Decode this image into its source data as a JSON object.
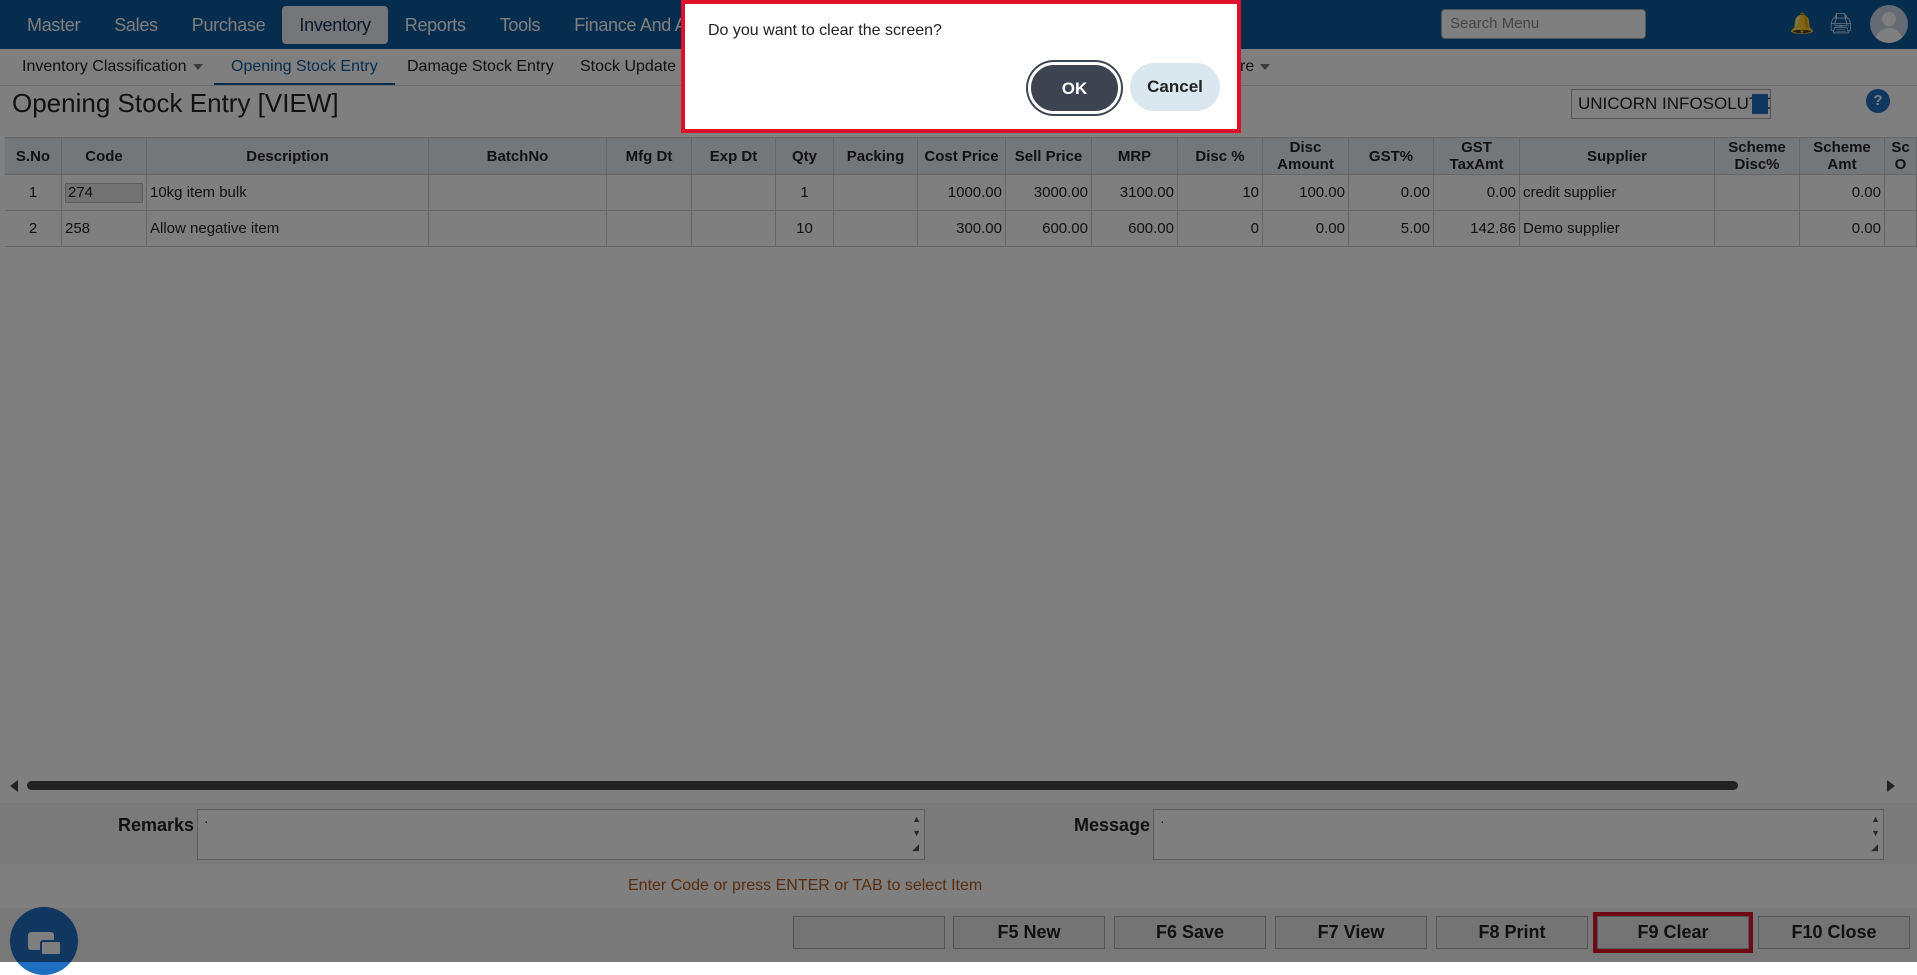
{
  "topnav": {
    "items": [
      "Master",
      "Sales",
      "Purchase",
      "Inventory",
      "Reports",
      "Tools",
      "Finance And Acc"
    ],
    "active": "Inventory",
    "search_placeholder": "Search Menu"
  },
  "subnav": {
    "items": [
      "Inventory Classification",
      "Opening Stock Entry",
      "Damage Stock Entry",
      "Stock Update",
      "re"
    ]
  },
  "page": {
    "title": "Opening Stock Entry [VIEW]",
    "company": "UNICORN INFOSOLUTIONS PR",
    "help": "?"
  },
  "table": {
    "headers": [
      "S.No",
      "Code",
      "Description",
      "BatchNo",
      "Mfg Dt",
      "Exp Dt",
      "Qty",
      "Packing",
      "Cost Price",
      "Sell Price",
      "MRP",
      "Disc %",
      "Disc Amount",
      "GST%",
      "GST TaxAmt",
      "Supplier",
      "Scheme Disc%",
      "Scheme Amt",
      "Sc O"
    ],
    "rows": [
      [
        "1",
        "274",
        "10kg item bulk",
        "",
        "",
        "",
        "1",
        "",
        "1000.00",
        "3000.00",
        "3100.00",
        "10",
        "100.00",
        "0.00",
        "0.00",
        "credit supplier",
        "",
        "0.00",
        ""
      ],
      [
        "2",
        "258",
        "Allow negative item",
        "",
        "",
        "",
        "10",
        "",
        "300.00",
        "600.00",
        "600.00",
        "0",
        "0.00",
        "5.00",
        "142.86",
        "Demo supplier",
        "",
        "0.00",
        ""
      ]
    ]
  },
  "footer": {
    "remarks_label": "Remarks",
    "remarks_value": "·",
    "message_label": "Message",
    "message_value": "·",
    "hint": "Enter Code or press ENTER or TAB to select Item",
    "buttons": [
      "",
      "F5 New",
      "F6 Save",
      "F7 View",
      "F8 Print",
      "F9 Clear",
      "F10 Close"
    ]
  },
  "dialog": {
    "message": "Do you want to clear the screen?",
    "ok": "OK",
    "cancel": "Cancel"
  }
}
